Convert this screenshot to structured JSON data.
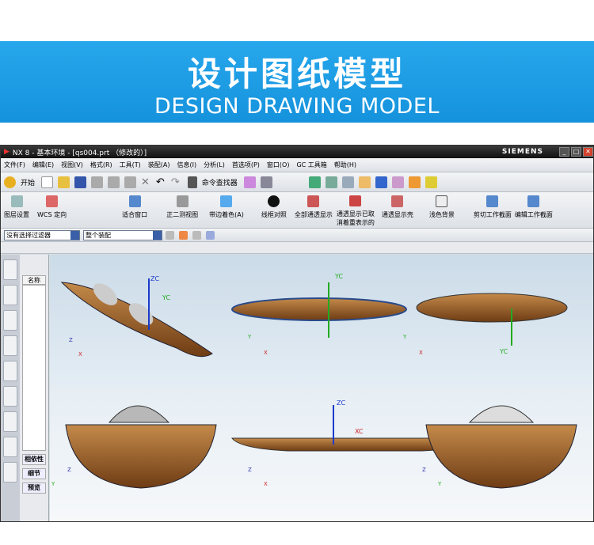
{
  "banner": {
    "title": "设计图纸模型",
    "subtitle": "DESIGN DRAWING MODEL"
  },
  "window": {
    "title": "NX 8 - 基本环境 - [qs004.prt （修改的）]",
    "brand": "SIEMENS"
  },
  "menu": [
    "文件(F)",
    "编辑(E)",
    "视图(V)",
    "格式(R)",
    "工具(T)",
    "装配(A)",
    "信息(I)",
    "分析(L)",
    "首选项(P)",
    "窗口(O)",
    "GC 工具箱",
    "帮助(H)"
  ],
  "toolbar": {
    "start": "开始",
    "command_finder": "命令查找器"
  },
  "big_toolbar": [
    "图层设置",
    "WCS 定向",
    "适合窗口",
    "正二测视图",
    "带边着色(A)",
    "线框对照",
    "全部通透显示",
    "通透显示已取消着重表示的",
    "通透显示壳",
    "浅色背景",
    "剪切工作截面",
    "编辑工作截面"
  ],
  "filter": {
    "selection_filter": "没有选择过滤器",
    "scope": "整个装配"
  },
  "nav": {
    "column": "名称",
    "buttons": [
      "相依性",
      "细节",
      "预览"
    ]
  },
  "axes": {
    "zc": "ZC",
    "yc": "YC",
    "xc": "XC",
    "x": "X",
    "y": "Y",
    "z": "Z"
  }
}
